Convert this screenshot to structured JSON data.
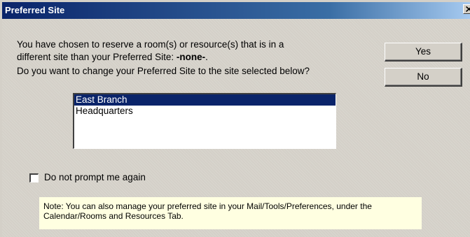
{
  "window": {
    "title": "Preferred Site"
  },
  "message": {
    "line1": "You have chosen to reserve a room(s) or resource(s) that is in a",
    "line2_prefix": "different site than your Preferred Site: ",
    "line2_value": "-none-",
    "line2_suffix": ".",
    "line3": "Do you want to change your Preferred Site to the site selected below?"
  },
  "buttons": {
    "yes_label": "Yes",
    "no_label": "No"
  },
  "sites": {
    "selected": "East Branch",
    "items": [
      {
        "label": "East Branch"
      },
      {
        "label": "Headquarters"
      }
    ]
  },
  "prompt_checkbox": {
    "label": "Do not prompt me again",
    "checked": false
  },
  "note": {
    "line1": "Note: You can also manage your preferred site in your Mail/Tools/Preferences, under the",
    "line2": "Calendar/Rooms and Resources Tab."
  },
  "colors": {
    "titlebar": "#0a246a",
    "dialog_bg": "#d4d0c8",
    "selection": "#0a246a",
    "note_bg": "#ffffe1"
  }
}
